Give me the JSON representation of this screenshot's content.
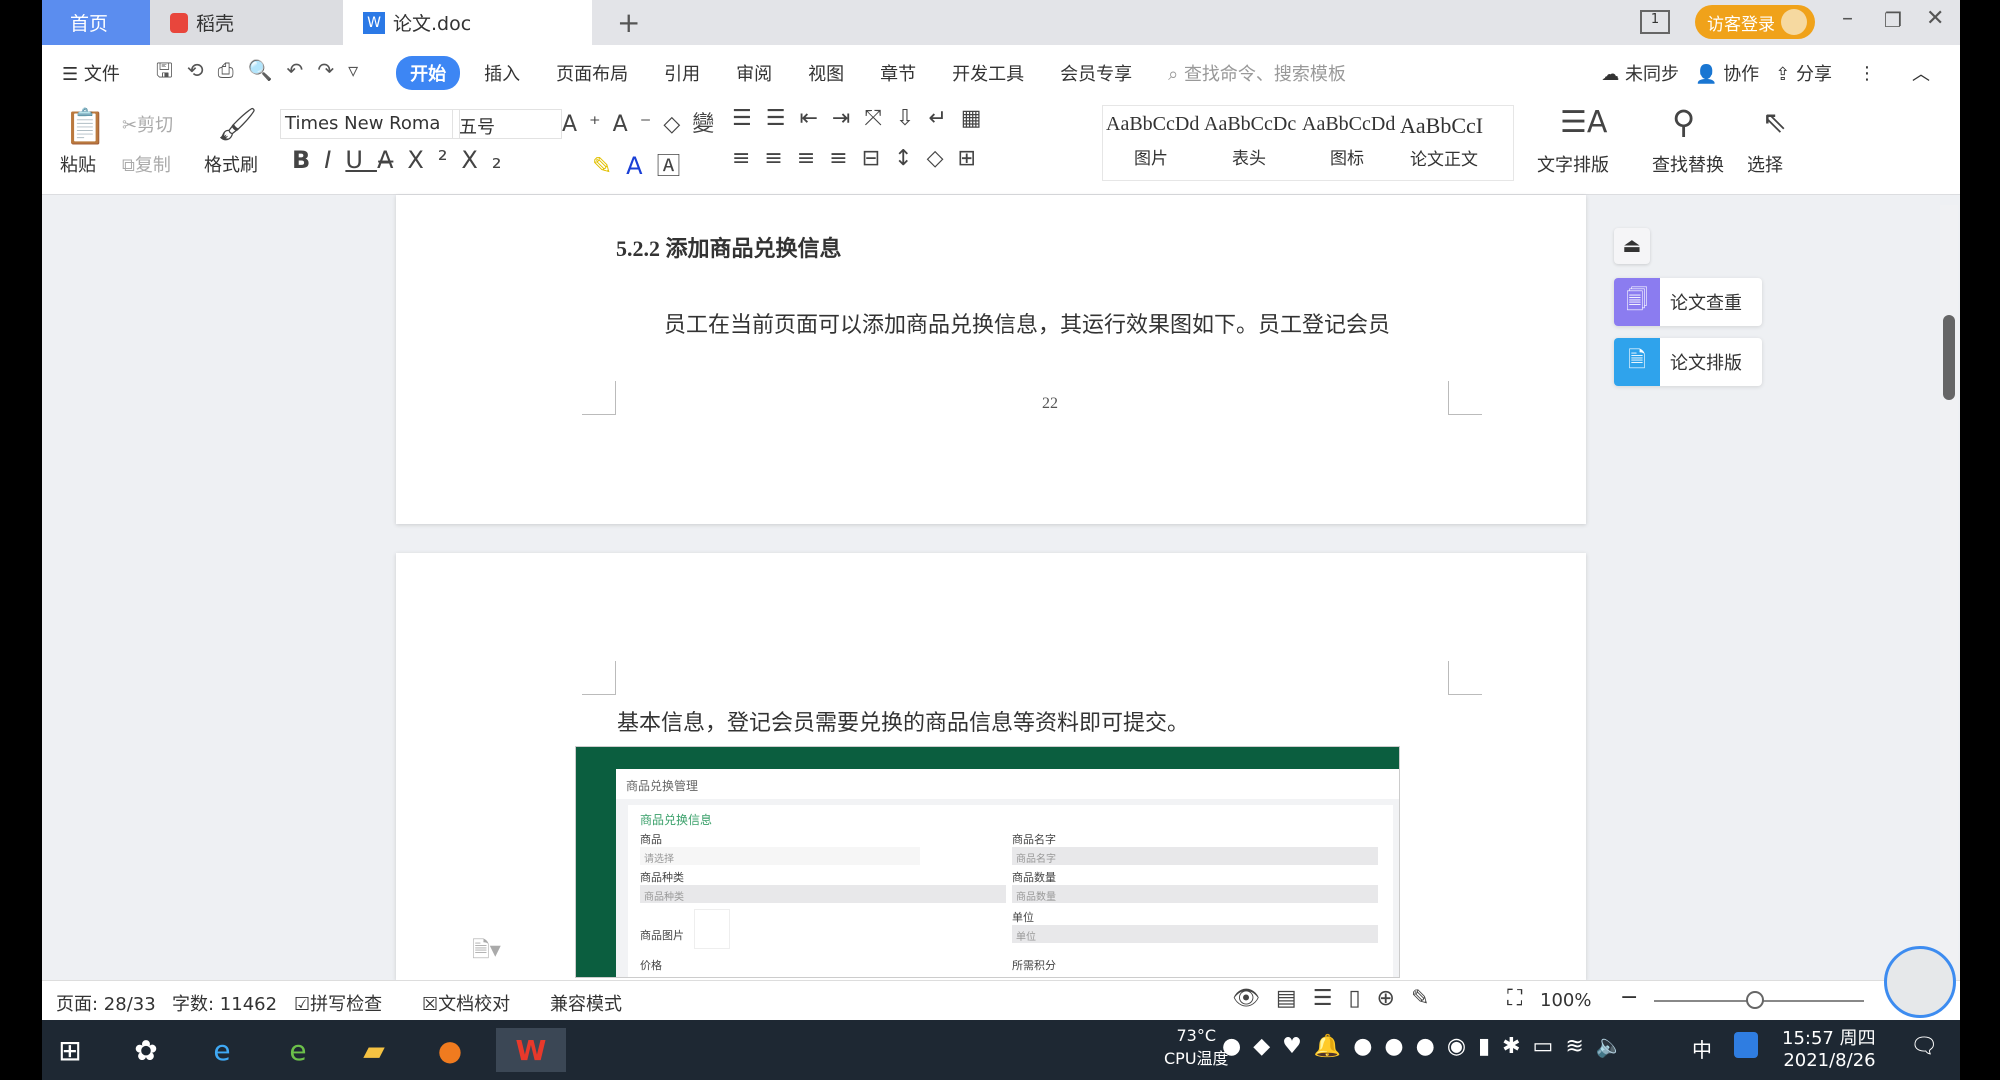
{
  "tabs": [
    {
      "label": "首页",
      "active": false
    },
    {
      "label": "稻壳",
      "active": false
    },
    {
      "label": "论文.doc",
      "active": true
    }
  ],
  "new_tab": "+",
  "guest_login": "访客登录",
  "menu": {
    "file": "文件",
    "items": [
      "开始",
      "插入",
      "页面布局",
      "引用",
      "审阅",
      "视图",
      "章节",
      "开发工具",
      "会员专享"
    ],
    "active": "开始",
    "search_placeholder": "查找命令、搜索模板",
    "sync": "未同步",
    "collab": "协作",
    "share": "分享"
  },
  "ribbon": {
    "paste": "粘贴",
    "cut": "剪切",
    "copy": "复制",
    "format_painter": "格式刷",
    "font": "Times New Roma",
    "size": "五号",
    "styles": [
      {
        "preview": "AaBbCcDd",
        "name": "图片"
      },
      {
        "preview": "AaBbCcDc",
        "name": "表头"
      },
      {
        "preview": "AaBbCcDd",
        "name": "图标"
      },
      {
        "preview": "AaBbCcI",
        "name": "论文正文"
      }
    ],
    "text_layout": "文字排版",
    "find_replace": "查找替换",
    "select": "选择"
  },
  "document": {
    "heading": "5.2.2  添加商品兑换信息",
    "para1": "员工在当前页面可以添加商品兑换信息，其运行效果图如下。员工登记会员",
    "page_number": "22",
    "para2": "基本信息，登记会员需要兑换的商品信息等资料即可提交。",
    "embedded": {
      "title": "商品兑换管理",
      "section": "商品兑换信息",
      "labels": [
        "商品",
        "商品名字",
        "商品种类",
        "商品数量",
        "商品图片",
        "单位",
        "价格",
        "所需积分"
      ],
      "placeholders": [
        "请选择",
        "商品名字",
        "商品种类",
        "商品数量",
        "单位"
      ],
      "theme_color": "#0b5e3f"
    }
  },
  "side_panel": {
    "check": "论文查重",
    "layout": "论文排版",
    "check_color": "#8b7cf0",
    "layout_color": "#2fa3ec"
  },
  "status": {
    "page": "页面: 28/33",
    "words": "字数: 11462",
    "spell": "拼写检查",
    "proof": "文档校对",
    "compat": "兼容模式",
    "zoom": "100%",
    "zoom_level": 100
  },
  "taskbar": {
    "temp": "73°C",
    "cpu": "CPU温度",
    "time": "15:57 周四",
    "date": "2021/8/26",
    "ime": "中"
  }
}
